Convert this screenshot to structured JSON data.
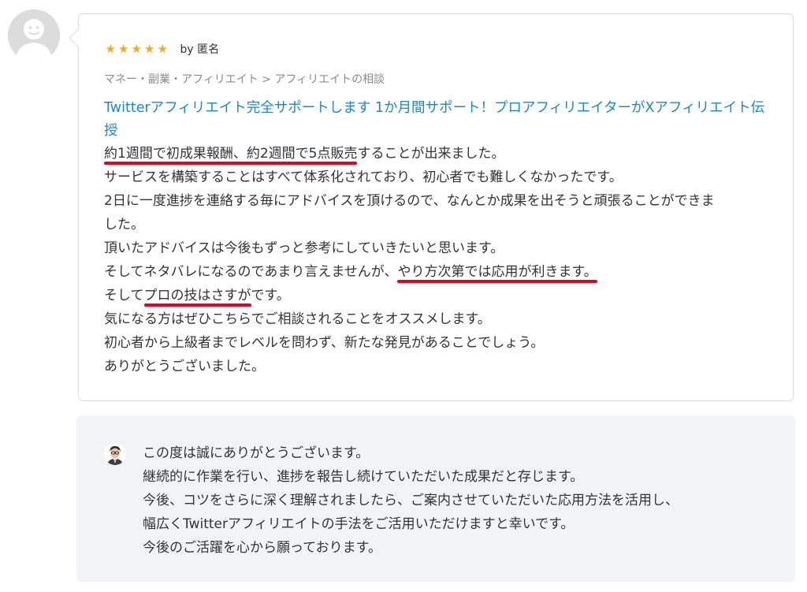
{
  "review": {
    "stars": [
      "★",
      "★",
      "★",
      "★",
      "★"
    ],
    "byline": "by 匿名",
    "breadcrumb": "マネー・副業・アフィリエイト > アフィリエイトの相談",
    "service_title": "Twitterアフィリエイト完全サポートします 1か月間サポート！プロアフィリエイターがXアフィリエイト伝授",
    "lines": {
      "l1_underlined": "約1週間で初成果報酬、約2週間で5点販売",
      "l1_rest": "することが出来ました。",
      "l2": "サービスを構築することはすべて体系化されており、初心者でも難しくなかったです。",
      "l3": "2日に一度進捗を連絡する毎にアドバイスを頂けるので、なんとか成果を出そうと頑張ることができま",
      "l4": "した。",
      "l5": "頂いたアドバイスは今後もずっと参考にしていきたいと思います。",
      "l6_pre": "そしてネタバレになるのであまり言えませんが、",
      "l6_underlined": "やり方次第では応用が利きます。",
      "l7_pre": "そして",
      "l7_underlined": "プロの技はさすが",
      "l7_rest": "です。",
      "l8": "気になる方はぜひこちらでご相談されることをオススメします。",
      "l9": "初心者から上級者までレベルを問わず、新たな発見があることでしょう。",
      "l10": "ありがとうございました。"
    },
    "colors": {
      "star": "#f5a623",
      "link": "#1a86d0",
      "underline": "#e8001f"
    }
  },
  "reply": {
    "lines": [
      "この度は誠にありがとうございます。",
      "継続的に作業を行い、進捗を報告し続けていただいた成果だと存じます。",
      "今後、コツをさらに深く理解されましたら、ご案内させていただいた応用方法を活用し、",
      "幅広くTwitterアフィリエイトの手法をご活用いただけますと幸いです。",
      "今後のご活躍を心から願っております。"
    ],
    "background": "#f1f3f5"
  },
  "icons": {
    "reviewer_avatar": "default-user-avatar-icon",
    "seller_avatar": "seller-portrait-icon"
  }
}
